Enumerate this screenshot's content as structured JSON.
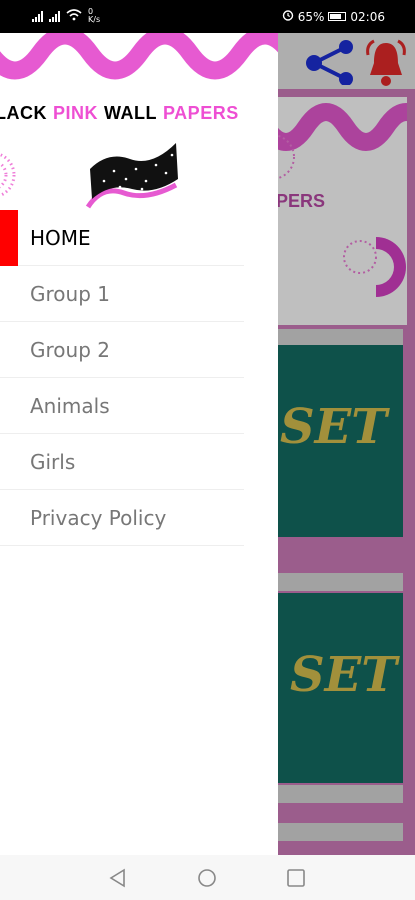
{
  "status_bar": {
    "data_rate": "0\nK/s",
    "battery": "65%",
    "time": "02:06"
  },
  "drawer": {
    "brand": {
      "word1": "LACK",
      "word2": "PINK",
      "word3": "WALL",
      "word4": "PAPERS"
    },
    "menu": [
      {
        "label": "HOME",
        "active": true
      },
      {
        "label": "Group 1",
        "active": false
      },
      {
        "label": "Group 2",
        "active": false
      },
      {
        "label": "Animals",
        "active": false
      },
      {
        "label": "Girls",
        "active": false
      },
      {
        "label": "Privacy Policy",
        "active": false
      }
    ]
  },
  "background_app": {
    "header_fragment": "PERS",
    "card_text": "SET"
  },
  "colors": {
    "accent_pink": "#ee4fd3",
    "active_indicator": "#ff0000",
    "card_teal": "#136c63",
    "card_text_gold": "#d8c14f"
  },
  "icons": [
    "share-icon",
    "bell-icon",
    "back-icon",
    "home-icon",
    "recents-icon"
  ]
}
